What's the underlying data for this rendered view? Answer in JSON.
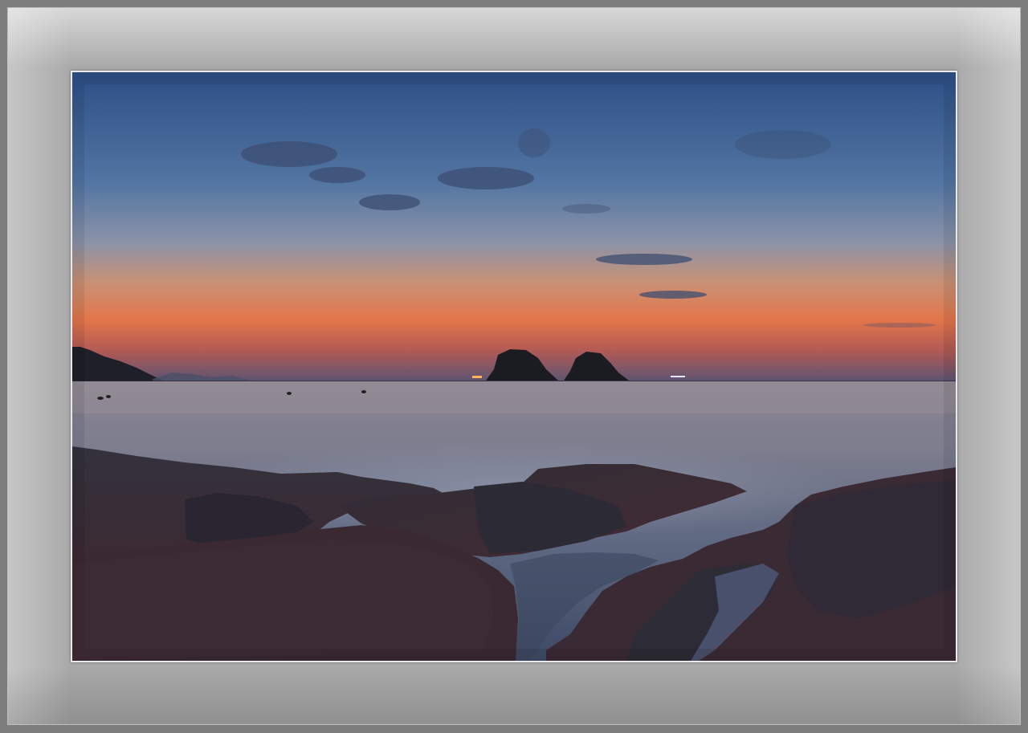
{
  "scene": {
    "subject": "sunset-over-sea-with-rocky-shore",
    "colors": {
      "sky_top": "#2f5287",
      "sky_mid": "#5f7ea8",
      "horizon_glow": "#e0683c",
      "sea": "#6b7488",
      "rocks": "#2c2830",
      "mat": "#a9a9a9",
      "frame_outer": "#7d7d7d"
    }
  }
}
